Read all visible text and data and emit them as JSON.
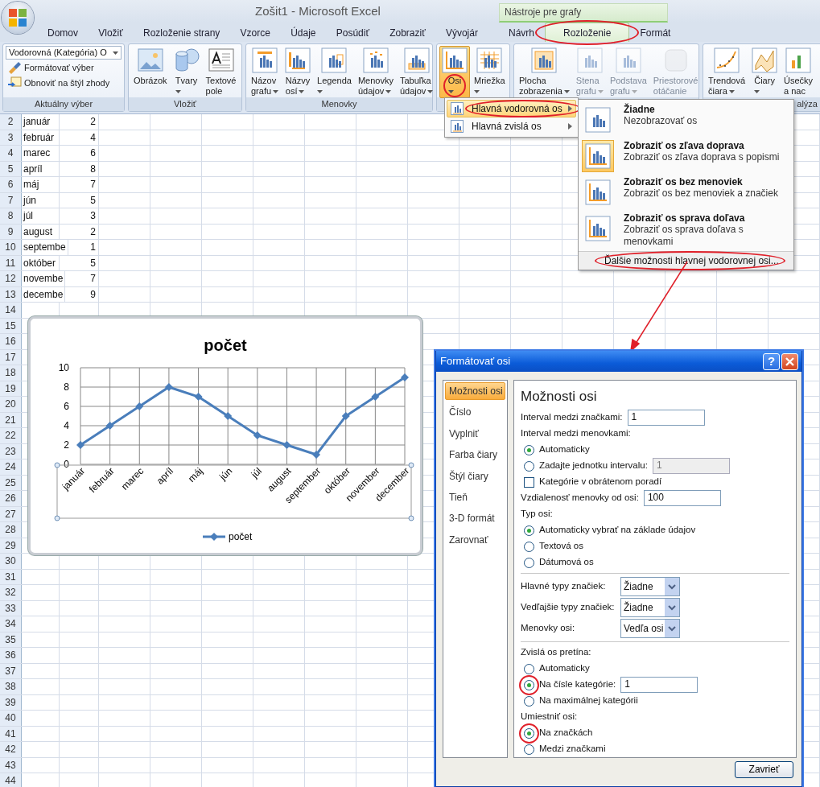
{
  "window": {
    "title": "Zošit1 - Microsoft Excel",
    "context_title": "Nástroje pre grafy"
  },
  "tabs": [
    {
      "label": "Domov",
      "selected": false,
      "kind": "normal"
    },
    {
      "label": "Vložiť",
      "selected": false,
      "kind": "normal"
    },
    {
      "label": "Rozloženie strany",
      "selected": false,
      "kind": "normal"
    },
    {
      "label": "Vzorce",
      "selected": false,
      "kind": "normal"
    },
    {
      "label": "Údaje",
      "selected": false,
      "kind": "normal"
    },
    {
      "label": "Posúdiť",
      "selected": false,
      "kind": "normal"
    },
    {
      "label": "Zobraziť",
      "selected": false,
      "kind": "normal"
    },
    {
      "label": "Vývojár",
      "selected": false,
      "kind": "normal"
    },
    {
      "label": "Návrh",
      "selected": false,
      "kind": "contextual"
    },
    {
      "label": "Rozloženie",
      "selected": true,
      "kind": "contextual",
      "highlighted": true
    },
    {
      "label": "Formát",
      "selected": false,
      "kind": "contextual"
    }
  ],
  "ribbon": {
    "groups": [
      {
        "kind": "selection",
        "label": "Aktuálny výber",
        "dropdown_value": "Vodorovná (Kategória) O",
        "buttons": [
          "Formátovať výber",
          "Obnoviť na štýl zhody"
        ]
      },
      {
        "kind": "buttons",
        "label": "Vložiť",
        "buttons": [
          {
            "label_lines": [
              "Obrázok"
            ],
            "dropdown": false,
            "disabled": false
          },
          {
            "label_lines": [
              "Tvary"
            ],
            "dropdown": true,
            "disabled": false
          },
          {
            "label_lines": [
              "Textové",
              "pole"
            ],
            "dropdown": false,
            "disabled": false
          }
        ]
      },
      {
        "kind": "buttons",
        "label": "Menovky",
        "buttons": [
          {
            "label_lines": [
              "Názov",
              "grafu"
            ],
            "dropdown": true,
            "disabled": false
          },
          {
            "label_lines": [
              "Názvy",
              "osí"
            ],
            "dropdown": true,
            "disabled": false
          },
          {
            "label_lines": [
              "Legenda"
            ],
            "dropdown": true,
            "disabled": false
          },
          {
            "label_lines": [
              "Menovky",
              "údajov"
            ],
            "dropdown": true,
            "disabled": false
          },
          {
            "label_lines": [
              "Tabuľka",
              "údajov"
            ],
            "dropdown": true,
            "disabled": false
          }
        ]
      },
      {
        "kind": "buttons",
        "buttons": [
          {
            "label_lines": [
              "Osi"
            ],
            "dropdown": true,
            "disabled": false,
            "pressed": true,
            "highlighted": true
          },
          {
            "label_lines": [
              "Mriežka"
            ],
            "dropdown": true,
            "disabled": false
          }
        ]
      },
      {
        "kind": "buttons",
        "buttons": [
          {
            "label_lines": [
              "Plocha",
              "zobrazenia"
            ],
            "dropdown": true,
            "disabled": false
          },
          {
            "label_lines": [
              "Stena",
              "grafu"
            ],
            "dropdown": true,
            "disabled": true
          },
          {
            "label_lines": [
              "Podstava",
              "grafu"
            ],
            "dropdown": true,
            "disabled": true
          },
          {
            "label_lines": [
              "Priestorové",
              "otáčanie"
            ],
            "dropdown": false,
            "disabled": true
          }
        ]
      },
      {
        "kind": "buttons",
        "label": "alýza",
        "buttons": [
          {
            "label_lines": [
              "Trendová",
              "čiara"
            ],
            "dropdown": true,
            "disabled": false
          },
          {
            "label_lines": [
              "Čiary"
            ],
            "dropdown": true,
            "disabled": false
          },
          {
            "label_lines": [
              "Úsečky",
              "a nac"
            ],
            "dropdown": false,
            "disabled": false
          }
        ]
      }
    ]
  },
  "sheet": {
    "rows": [
      {
        "number": "2",
        "cells": [
          "január",
          "2"
        ]
      },
      {
        "number": "3",
        "cells": [
          "február",
          "4"
        ]
      },
      {
        "number": "4",
        "cells": [
          "marec",
          "6"
        ]
      },
      {
        "number": "5",
        "cells": [
          "apríl",
          "8"
        ]
      },
      {
        "number": "6",
        "cells": [
          "máj",
          "7"
        ]
      },
      {
        "number": "7",
        "cells": [
          "jún",
          "5"
        ]
      },
      {
        "number": "8",
        "cells": [
          "júl",
          "3"
        ]
      },
      {
        "number": "9",
        "cells": [
          "august",
          "2"
        ]
      },
      {
        "number": "10",
        "cells": [
          "septembe",
          "1"
        ]
      },
      {
        "number": "11",
        "cells": [
          "október",
          "5"
        ]
      },
      {
        "number": "12",
        "cells": [
          "novembe",
          "7"
        ]
      },
      {
        "number": "13",
        "cells": [
          "decembe",
          "9"
        ]
      },
      {
        "number": "14"
      },
      {
        "number": "15"
      },
      {
        "number": "16"
      },
      {
        "number": "17"
      },
      {
        "number": "18"
      },
      {
        "number": "19"
      },
      {
        "number": "20"
      },
      {
        "number": "21"
      },
      {
        "number": "22"
      },
      {
        "number": "23"
      },
      {
        "number": "24"
      },
      {
        "number": "25"
      },
      {
        "number": "26"
      },
      {
        "number": "27"
      },
      {
        "number": "28"
      },
      {
        "number": "29"
      },
      {
        "number": "30"
      },
      {
        "number": "31"
      },
      {
        "number": "32"
      },
      {
        "number": "33"
      },
      {
        "number": "34"
      },
      {
        "number": "35"
      },
      {
        "number": "36"
      },
      {
        "number": "37"
      },
      {
        "number": "38"
      },
      {
        "number": "39"
      },
      {
        "number": "40"
      },
      {
        "number": "41"
      },
      {
        "number": "42"
      },
      {
        "number": "43"
      },
      {
        "number": "44"
      }
    ]
  },
  "chart": {
    "chart_data": {
      "type": "line",
      "title": "počet",
      "categories": [
        "január",
        "február",
        "marec",
        "apríl",
        "máj",
        "jún",
        "júl",
        "august",
        "september",
        "október",
        "november",
        "december"
      ],
      "series": [
        {
          "name": "počet",
          "color": "#4a7ebb",
          "marker": "diamond",
          "values": [
            2,
            4,
            6,
            8,
            7,
            5,
            3,
            2,
            1,
            5,
            7,
            9
          ]
        }
      ],
      "ylim": [
        0,
        10
      ],
      "yticks": [
        0,
        2,
        4,
        6,
        8,
        10
      ],
      "grid": true
    },
    "axis_selected": true
  },
  "axis_menu": {
    "items": [
      {
        "label": "Hlavná vodorovná os",
        "selected": true,
        "highlighted": true
      },
      {
        "label": "Hlavná zvislá os",
        "selected": false
      }
    ]
  },
  "axis_submenu": {
    "options": [
      {
        "title": "Žiadne",
        "description": "Nezobrazovať os",
        "selected": false
      },
      {
        "title": "Zobraziť os zľava doprava",
        "description": "Zobraziť os zľava doprava s popismi",
        "selected": true
      },
      {
        "title": "Zobraziť os bez menoviek",
        "description": "Zobraziť os bez menoviek a značiek",
        "selected": false
      },
      {
        "title": "Zobraziť os sprava doľava",
        "description": "Zobraziť os sprava doľava s menovkami",
        "selected": false
      }
    ],
    "footer": "Ďalšie možnosti hlavnej vodorovnej osi...",
    "footer_highlighted": true
  },
  "dialog": {
    "title": "Formátovať osi",
    "help_label": "?",
    "nav": [
      {
        "label": "Možnosti osi",
        "selected": true
      },
      {
        "label": "Číslo",
        "selected": false
      },
      {
        "label": "Vyplniť",
        "selected": false
      },
      {
        "label": "Farba čiary",
        "selected": false
      },
      {
        "label": "Štýl čiary",
        "selected": false
      },
      {
        "label": "Tieň",
        "selected": false
      },
      {
        "label": "3-D formát",
        "selected": false
      },
      {
        "label": "Zarovnať",
        "selected": false
      }
    ],
    "heading": "Možnosti osi",
    "controls": [
      {
        "kind": "field",
        "label": "Interval medzi značkami:",
        "value": "1",
        "disabled": false
      },
      {
        "kind": "label",
        "label": "Interval medzi menovkami:"
      },
      {
        "kind": "radio",
        "label": "Automaticky",
        "checked": true
      },
      {
        "kind": "radio",
        "label": "Zadajte jednotku intervalu:",
        "checked": false,
        "field": {
          "value": "1",
          "disabled": true
        }
      },
      {
        "kind": "checkbox",
        "label": "Kategórie v obrátenom poradí",
        "checked": false
      },
      {
        "kind": "field",
        "label": "Vzdialenosť menovky od osi:",
        "value": "100",
        "disabled": false
      },
      {
        "kind": "label",
        "label": "Typ osi:"
      },
      {
        "kind": "radio",
        "label": "Automaticky vybrať na základe údajov",
        "checked": true
      },
      {
        "kind": "radio",
        "label": "Textová os",
        "checked": false
      },
      {
        "kind": "radio",
        "label": "Dátumová os",
        "checked": false
      },
      {
        "kind": "separator"
      },
      {
        "kind": "select",
        "label": "Hlavné typy značiek:",
        "value": "Žiadne"
      },
      {
        "kind": "select",
        "label": "Vedľajšie typy značiek:",
        "value": "Žiadne"
      },
      {
        "kind": "select",
        "label": "Menovky osi:",
        "value": "Vedľa osi"
      },
      {
        "kind": "separator"
      },
      {
        "kind": "label",
        "label": "Zvislá os pretína:"
      },
      {
        "kind": "radio",
        "label": "Automaticky",
        "checked": false
      },
      {
        "kind": "radio",
        "label": "Na čísle kategórie:",
        "checked": true,
        "highlighted": true,
        "field": {
          "value": "1",
          "disabled": false
        }
      },
      {
        "kind": "radio",
        "label": "Na maximálnej kategórii",
        "checked": false
      },
      {
        "kind": "label",
        "label": "Umiestniť osi:"
      },
      {
        "kind": "radio",
        "label": "Na značkách",
        "checked": true,
        "highlighted": true
      },
      {
        "kind": "radio",
        "label": "Medzi značkami",
        "checked": false
      }
    ],
    "close_button": "Zavrieť"
  }
}
